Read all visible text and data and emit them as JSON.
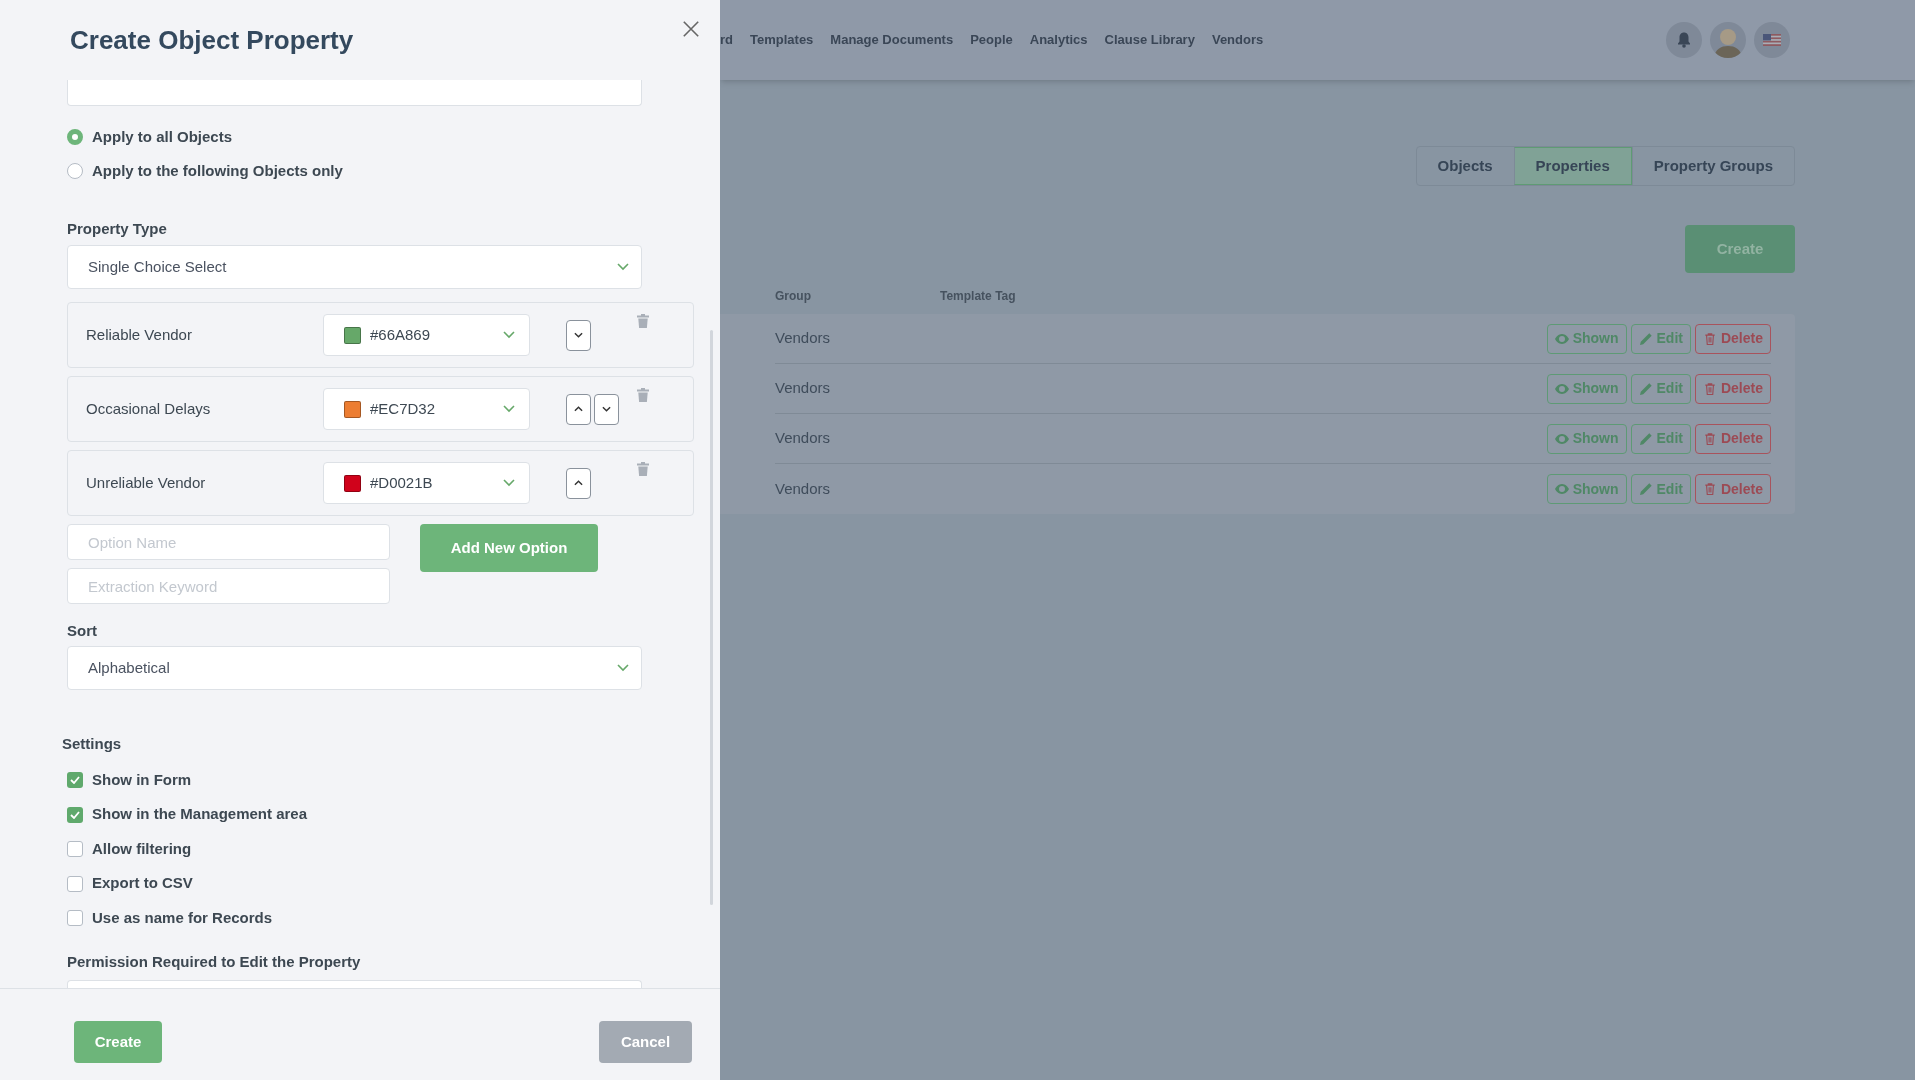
{
  "modal": {
    "title": "Create Object Property",
    "apply_options": [
      {
        "label": "Apply to all Objects",
        "selected": true
      },
      {
        "label": "Apply to the following Objects only",
        "selected": false
      }
    ],
    "property_type": {
      "label": "Property Type",
      "value": "Single Choice Select"
    },
    "options": [
      {
        "name": "Reliable Vendor",
        "color": "#66a869",
        "hex": "#66A869",
        "move_up": false,
        "move_down": true
      },
      {
        "name": "Occasional Delays",
        "color": "#ec7d32",
        "hex": "#EC7D32",
        "move_up": true,
        "move_down": true
      },
      {
        "name": "Unreliable Vendor",
        "color": "#d0021b",
        "hex": "#D0021B",
        "move_up": true,
        "move_down": false
      }
    ],
    "option_name": {
      "placeholder": "Option Name"
    },
    "extraction_keyword": {
      "placeholder": "Extraction Keyword"
    },
    "add_option_button": "Add New Option",
    "sort": {
      "label": "Sort",
      "value": "Alphabetical"
    },
    "settings_label": "Settings",
    "settings": [
      {
        "label": "Show in Form",
        "checked": true
      },
      {
        "label": "Show in the Management area",
        "checked": true
      },
      {
        "label": "Allow filtering",
        "checked": false
      },
      {
        "label": "Export to CSV",
        "checked": false
      },
      {
        "label": "Use as name for Records",
        "checked": false
      }
    ],
    "permission_label": "Permission Required to Edit the Property",
    "create_button": "Create",
    "cancel_button": "Cancel"
  },
  "background": {
    "nav": [
      "rd",
      "Templates",
      "Manage Documents",
      "People",
      "Analytics",
      "Clause Library",
      "Vendors"
    ],
    "tabs": [
      {
        "label": "Objects",
        "selected": false
      },
      {
        "label": "Properties",
        "selected": true
      },
      {
        "label": "Property Groups",
        "selected": false
      }
    ],
    "create_button": "Create",
    "columns": [
      "Group",
      "Template Tag"
    ],
    "rows": [
      {
        "group": "Vendors",
        "shown": "Shown",
        "edit": "Edit",
        "delete": "Delete"
      },
      {
        "group": "Vendors",
        "shown": "Shown",
        "edit": "Edit",
        "delete": "Delete"
      },
      {
        "group": "Vendors",
        "shown": "Shown",
        "edit": "Edit",
        "delete": "Delete"
      },
      {
        "group": "Vendors",
        "shown": "Shown",
        "edit": "Edit",
        "delete": "Delete"
      }
    ]
  }
}
